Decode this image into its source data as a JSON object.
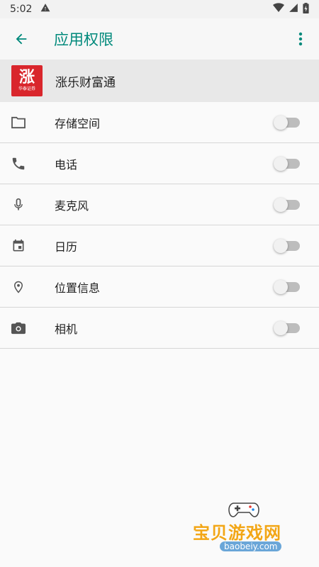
{
  "status_bar": {
    "time": "5:02",
    "icons": [
      "warning-icon",
      "wifi-icon",
      "signal-icon",
      "battery-icon"
    ]
  },
  "app_bar": {
    "title": "应用权限",
    "back_icon": "arrow-left-icon",
    "menu_icon": "more-vert-icon",
    "accent_color": "#00897b"
  },
  "app": {
    "name": "涨乐财富通",
    "logo_char": "涨",
    "logo_subtext": "华泰证券",
    "logo_color": "#d9262c"
  },
  "permissions": [
    {
      "label": "存储空间",
      "icon": "folder-icon",
      "enabled": false
    },
    {
      "label": "电话",
      "icon": "phone-icon",
      "enabled": false
    },
    {
      "label": "麦克风",
      "icon": "microphone-icon",
      "enabled": false
    },
    {
      "label": "日历",
      "icon": "calendar-icon",
      "enabled": false
    },
    {
      "label": "位置信息",
      "icon": "location-icon",
      "enabled": false
    },
    {
      "label": "相机",
      "icon": "camera-icon",
      "enabled": false
    }
  ],
  "watermark": {
    "text": "宝贝游戏网",
    "url": "baobeiy.com"
  }
}
